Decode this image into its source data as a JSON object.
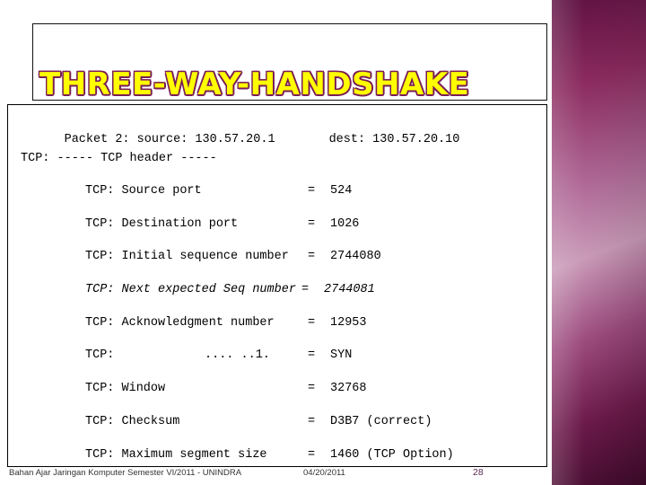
{
  "slide": {
    "title": "THREE-WAY-HANDSHAKE",
    "header": {
      "packet": "Packet 2: source: 130.57.20.1",
      "dest": "dest: 130.57.20.10"
    },
    "subheader": "TCP: ----- TCP header -----",
    "rows": [
      {
        "label": "TCP: Source port",
        "eq": "=",
        "value": "524",
        "italic": false
      },
      {
        "label": "TCP: Destination port",
        "eq": "=",
        "value": "1026",
        "italic": false
      },
      {
        "label": "TCP: Initial sequence number",
        "eq": "=",
        "value": "2744080",
        "italic": false
      },
      {
        "label": "TCP: Next expected Seq number",
        "eq": "=",
        "value": "2744081",
        "italic": true
      },
      {
        "label": "TCP: Acknowledgment number",
        "eq": "=",
        "value": "12953",
        "italic": false
      },
      {
        "label": "TCP:",
        "flagbits": ".... ..1.",
        "eq": "=",
        "value": "SYN",
        "italic": false
      },
      {
        "label": "TCP: Window",
        "eq": "=",
        "value": "32768",
        "italic": false
      },
      {
        "label": "TCP: Checksum",
        "eq": "=",
        "value": "D3B7 (correct)",
        "italic": false
      },
      {
        "label": "TCP: Maximum segment size",
        "eq": "=",
        "value": "1460 (TCP Option)",
        "italic": false
      }
    ],
    "footer": {
      "left": "Bahan Ajar Jaringan Komputer Semester VI/2011 - UNINDRA",
      "date": "04/20/2011",
      "page": "28"
    },
    "colors": {
      "title_fill": "#ffff00",
      "title_outline": "#7a1d55",
      "band_dark": "#5c1040",
      "band_light": "#c99ab8",
      "page_number": "#5a2a52"
    }
  }
}
